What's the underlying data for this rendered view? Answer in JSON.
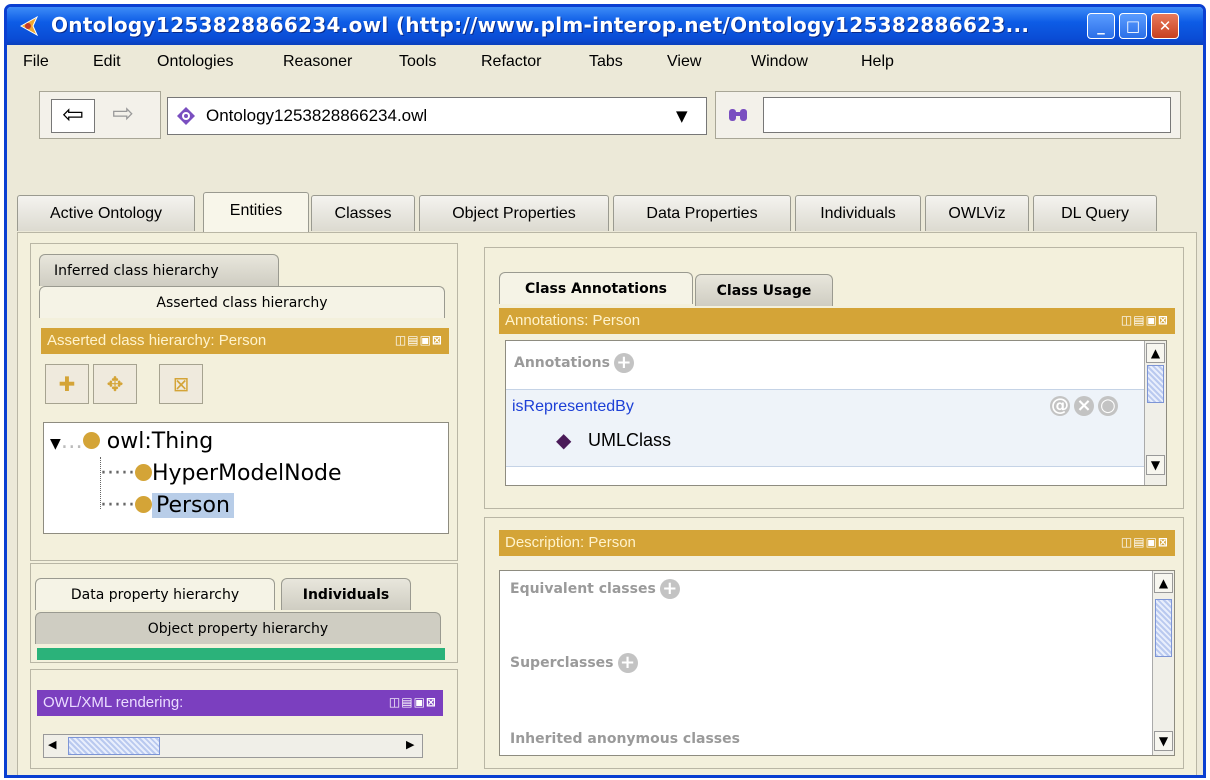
{
  "title": "Ontology1253828866234.owl (http://www.plm-interop.net/Ontology125382886623...",
  "window_buttons": {
    "minimize": "_",
    "maximize": "□",
    "close": "✕"
  },
  "menu": [
    "File",
    "Edit",
    "Ontologies",
    "Reasoner",
    "Tools",
    "Refactor",
    "Tabs",
    "View",
    "Window",
    "Help"
  ],
  "toolbar": {
    "back": "⇦",
    "forward": "⇨",
    "ontology_selected": "Ontology1253828866234.owl",
    "dropdown_arrow": "▼",
    "search_icon": "binoculars-icon",
    "search_value": ""
  },
  "tabs": [
    "Active Ontology",
    "Entities",
    "Classes",
    "Object Properties",
    "Data Properties",
    "Individuals",
    "OWLViz",
    "DL Query"
  ],
  "selected_tab": "Entities",
  "left": {
    "class_tabs": [
      "Inferred class hierarchy",
      "Asserted class hierarchy"
    ],
    "class_panel_title": "Asserted class hierarchy: Person",
    "tree": {
      "root": "owl:Thing",
      "children": [
        "HyperModelNode",
        "Person"
      ],
      "selected": "Person"
    },
    "prop_tabs": [
      "Data property hierarchy",
      "Individuals",
      "Object property hierarchy"
    ],
    "owlxml_title": "OWL/XML rendering:"
  },
  "right": {
    "ann_tabs": [
      "Class Annotations",
      "Class Usage"
    ],
    "ann_panel_title": "Annotations: Person",
    "annotations_label": "Annotations",
    "annotation": {
      "property": "isRepresentedBy",
      "value": "UMLClass"
    },
    "desc_panel_title": "Description: Person",
    "sections": [
      "Equivalent classes",
      "Superclasses",
      "Inherited anonymous classes"
    ]
  },
  "colors": {
    "panel_title": "#d4a437",
    "green_bar": "#2bb27a",
    "owlxml_bar": "#7b3fbf",
    "link": "#1c3fd6"
  }
}
